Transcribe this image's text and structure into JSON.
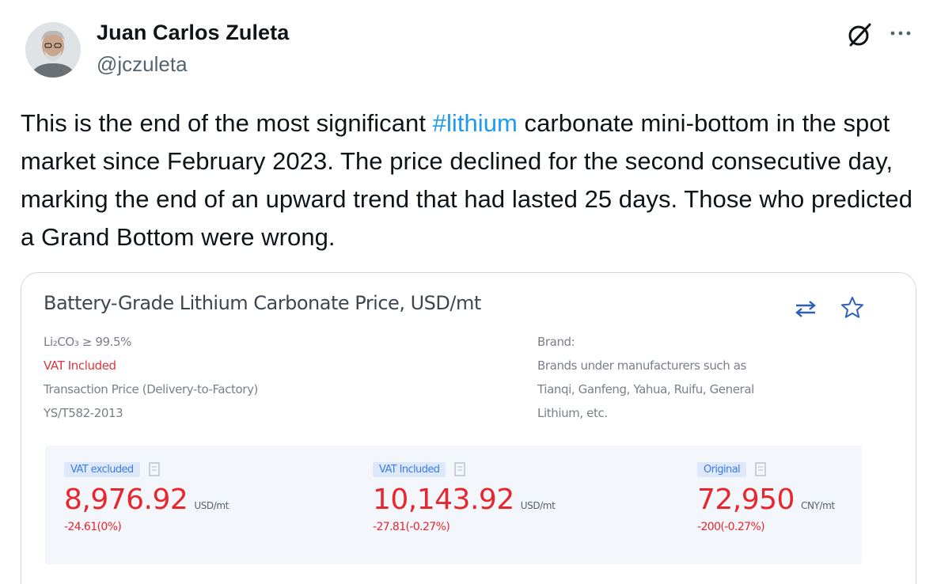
{
  "author": {
    "name": "Juan Carlos Zuleta",
    "handle": "@jczuleta"
  },
  "icons": {
    "grok": "grok-icon",
    "more": "more-horizontal-icon",
    "swap": "swap-arrows-icon",
    "star": "star-icon",
    "doc": "document-icon"
  },
  "tweet": {
    "text_before": "This is the end of the most significant ",
    "hashtag": "#lithium",
    "text_after": " carbonate mini-bottom in the spot market since February 2023. The price declined for the second consecutive day, marking the end of an upward trend that had lasted 25 days. Those who predicted a Grand Bottom were wrong."
  },
  "media": {
    "title": "Battery-Grade Lithium Carbonate Price, USD/mt",
    "specs_left": [
      "Li₂CO₃ ≥ 99.5%",
      "VAT Included",
      "Transaction Price (Delivery-to-Factory)",
      "YS/T582-2013"
    ],
    "specs_right": [
      "Brand:",
      "Brands under manufacturers such as",
      "Tianqi, Ganfeng, Yahua, Ruifu, General",
      "Lithium, etc."
    ],
    "prices": [
      {
        "tag": "VAT excluded",
        "value": "8,976.92",
        "unit": "USD/mt",
        "change": "-24.61(0%)"
      },
      {
        "tag": "VAT Included",
        "value": "10,143.92",
        "unit": "USD/mt",
        "change": "-27.81(-0.27%)"
      },
      {
        "tag": "Original",
        "value": "72,950",
        "unit": "CNY/mt",
        "change": "-200(-0.27%)"
      }
    ]
  },
  "colors": {
    "hashtag": "#1d9bf0",
    "price_red": "#e8262e",
    "tag_blue": "#3d7be0"
  }
}
